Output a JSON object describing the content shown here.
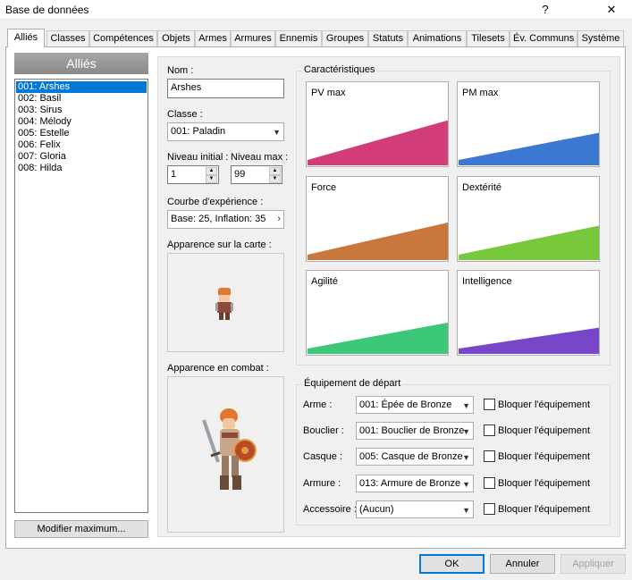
{
  "window": {
    "title": "Base de données",
    "help_label": "?",
    "close_label": "✕"
  },
  "tabs": [
    {
      "label": "Alliés",
      "active": true
    },
    {
      "label": "Classes"
    },
    {
      "label": "Compétences"
    },
    {
      "label": "Objets"
    },
    {
      "label": "Armes"
    },
    {
      "label": "Armures"
    },
    {
      "label": "Ennemis"
    },
    {
      "label": "Groupes"
    },
    {
      "label": "Statuts"
    },
    {
      "label": "Animations"
    },
    {
      "label": "Tilesets"
    },
    {
      "label": "Év. Communs"
    },
    {
      "label": "Système"
    }
  ],
  "list": {
    "header": "Alliés",
    "items": [
      "001: Arshes",
      "002: Basil",
      "003: Sirus",
      "004: Mélody",
      "005: Estelle",
      "006: Felix",
      "007: Gloria",
      "008: Hilda"
    ],
    "selected_index": 0,
    "modify_max_label": "Modifier maximum..."
  },
  "form": {
    "name_label": "Nom :",
    "name_value": "Arshes",
    "class_label": "Classe :",
    "class_value": "001: Paladin",
    "initial_level_label": "Niveau initial :",
    "initial_level_value": "1",
    "max_level_label": "Niveau max :",
    "max_level_value": "99",
    "exp_curve_label": "Courbe d'expérience :",
    "exp_curve_value": "Base: 25, Inflation: 35",
    "map_appearance_label": "Apparence sur la carte :",
    "battle_appearance_label": "Apparence en combat :"
  },
  "characteristics": {
    "title": "Caractéristiques",
    "charts": [
      {
        "label": "PV max",
        "color": "#d23c78",
        "end_level": 0.72
      },
      {
        "label": "PM max",
        "color": "#3c78d2",
        "end_level": 0.52
      },
      {
        "label": "Force",
        "color": "#c8783c",
        "end_level": 0.6
      },
      {
        "label": "Dextérité",
        "color": "#78c83c",
        "end_level": 0.55
      },
      {
        "label": "Agilité",
        "color": "#3cc878",
        "end_level": 0.5
      },
      {
        "label": "Intelligence",
        "color": "#7846c8",
        "end_level": 0.42
      }
    ]
  },
  "equipment": {
    "title": "Équipement de départ",
    "lock_label": "Bloquer l'équipement",
    "slots": [
      {
        "label": "Arme :",
        "value": "001: Épée de Bronze"
      },
      {
        "label": "Bouclier :",
        "value": "001: Bouclier de Bronze"
      },
      {
        "label": "Casque :",
        "value": "005: Casque de Bronze"
      },
      {
        "label": "Armure :",
        "value": "013: Armure de Bronze"
      },
      {
        "label": "Accessoire :",
        "value": "(Aucun)"
      }
    ]
  },
  "footer": {
    "ok_label": "OK",
    "cancel_label": "Annuler",
    "apply_label": "Appliquer"
  }
}
